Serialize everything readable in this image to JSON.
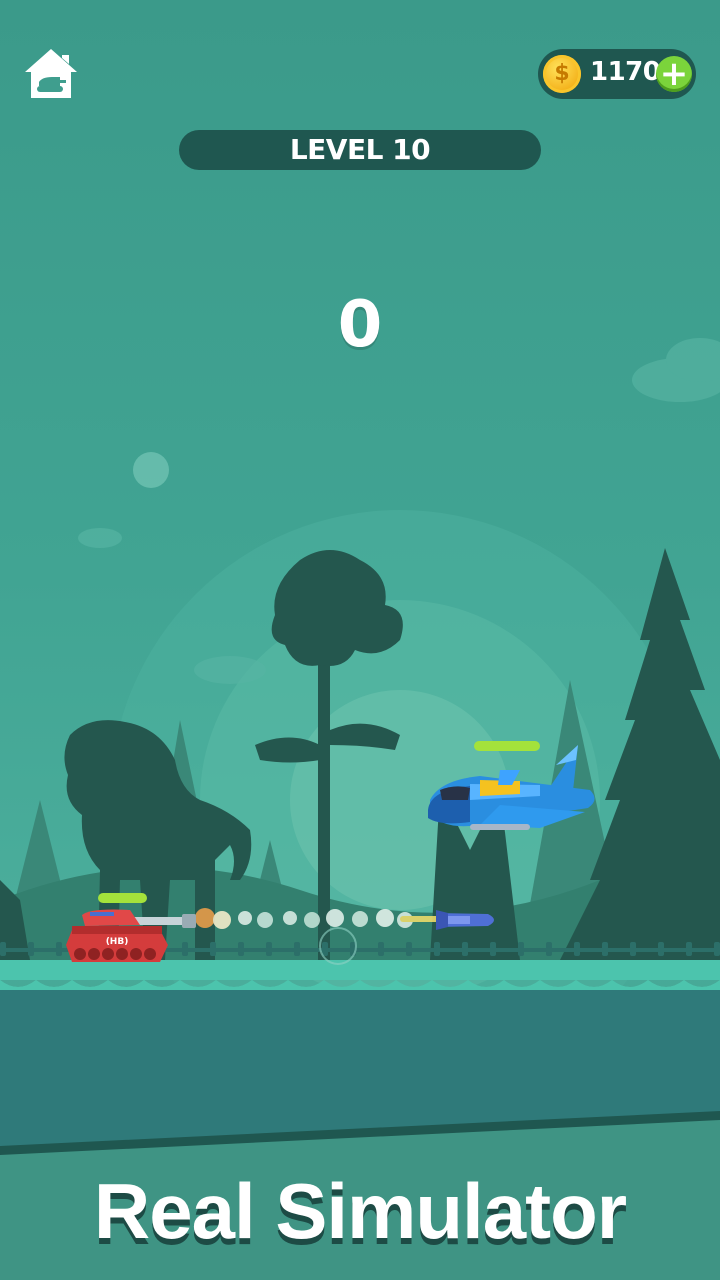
{
  "hud": {
    "home_icon": "home-tank-icon",
    "coins": "1170",
    "coin_symbol": "$",
    "add_symbol": "+",
    "level_label": "LEVEL 10",
    "score": "0"
  },
  "player": {
    "tank_badge": "(HB)",
    "health_fraction": 1.0
  },
  "enemy": {
    "type": "jet-fighter",
    "health_fraction": 1.0
  },
  "caption": "Real Simulator",
  "colors": {
    "sky": "#41a493",
    "panel": "#1f5750",
    "silhouette": "#24574e",
    "health": "#a4e23b",
    "ground_top": "#4cc4ad",
    "ground": "#2f7a7a",
    "tank": "#d43c3c",
    "jet": "#2a8ee0"
  }
}
